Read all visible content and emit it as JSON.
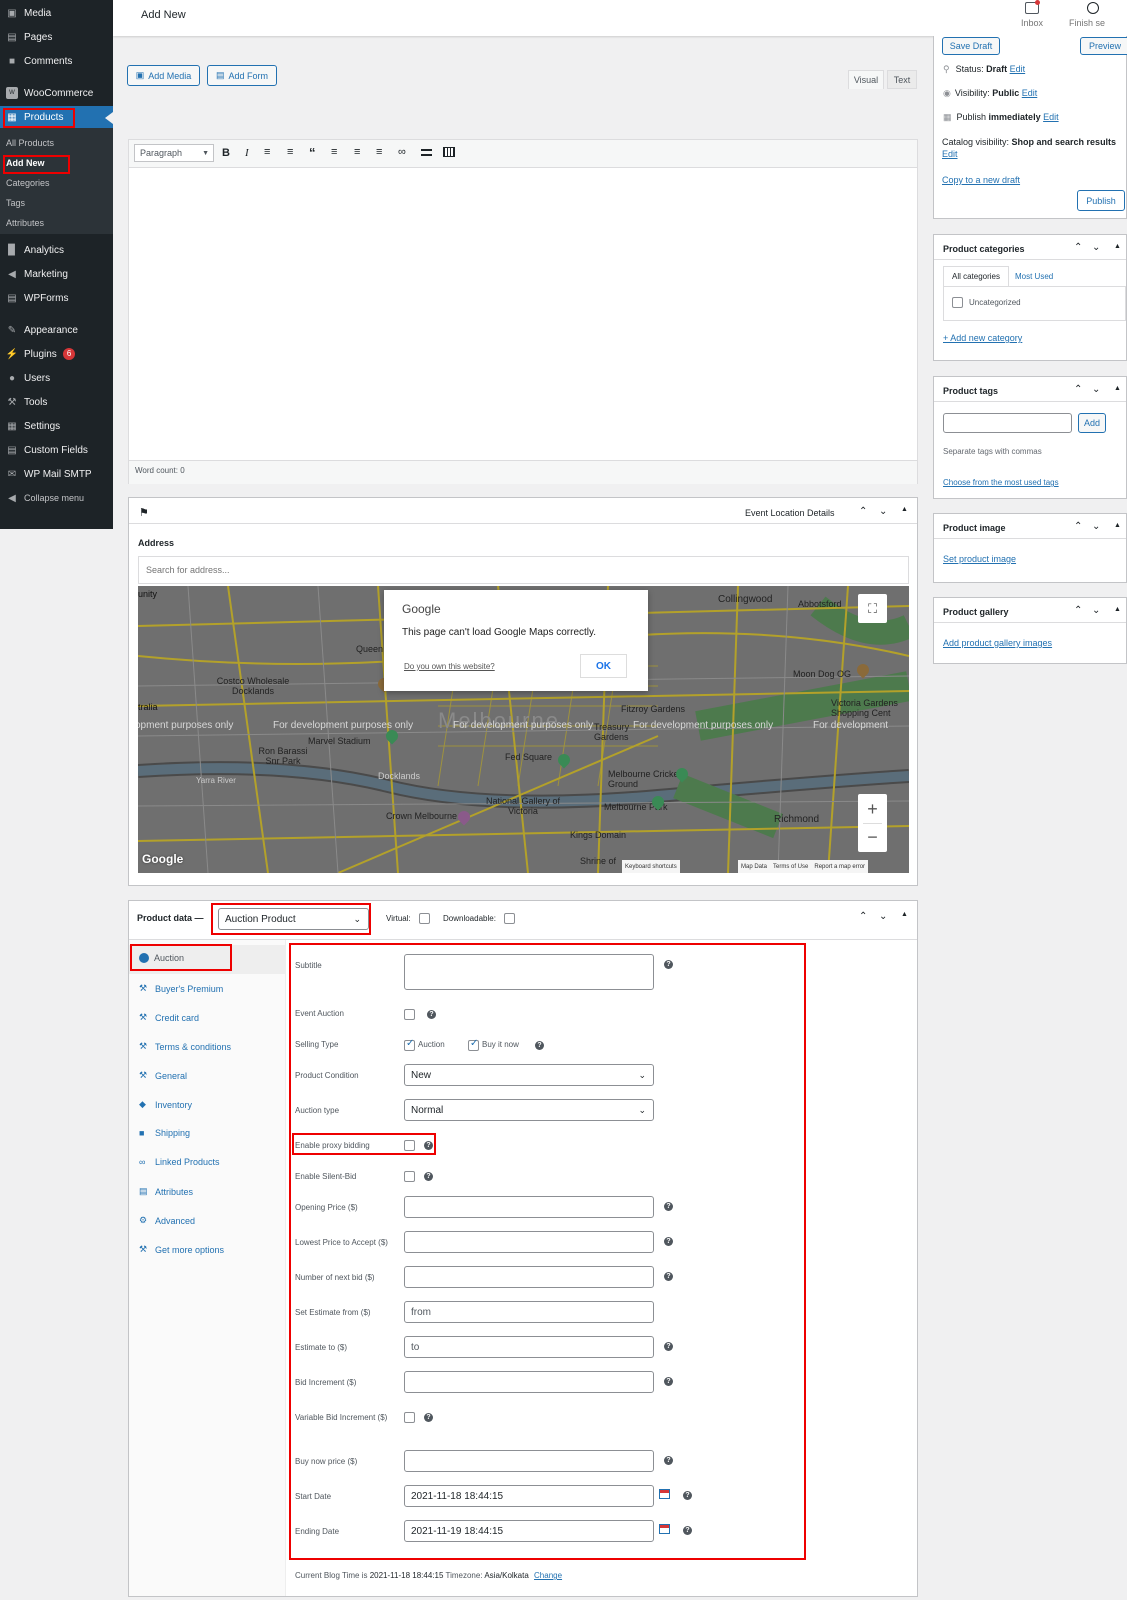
{
  "sidebar": {
    "top_items": [
      "Media",
      "Pages",
      "Comments"
    ],
    "woocommerce": "WooCommerce",
    "products": "Products",
    "submenu": [
      "All Products",
      "Add New",
      "Categories",
      "Tags",
      "Attributes"
    ],
    "items": [
      "Analytics",
      "Marketing",
      "WPForms",
      "Appearance",
      "Plugins",
      "Users",
      "Tools",
      "Settings",
      "Custom Fields",
      "WP Mail SMTP",
      "Collapse menu"
    ],
    "plugins_badge": "6"
  },
  "topbar": {
    "title": "Add New",
    "inbox": "Inbox",
    "finish": "Finish se"
  },
  "editor": {
    "add_media": "Add Media",
    "add_form": "Add Form",
    "tab_visual": "Visual",
    "tab_text": "Text",
    "format": "Paragraph",
    "word_count": "Word count: 0"
  },
  "event_box": {
    "title": "Event Location Details",
    "address_label": "Address",
    "address_placeholder": "Search for address...",
    "map": {
      "dialog_brand": "Google",
      "dialog_msg": "This page can't load Google Maps correctly.",
      "dialog_link": "Do you own this website?",
      "dialog_ok": "OK",
      "dev_text": "For development purposes only",
      "dev_left": "opment purposes only",
      "dev_right": "For development",
      "city": "Melbourne",
      "places": [
        "Collingwood",
        "Abbotsford",
        "Queen",
        "Costco Wholesale Docklands",
        "Moon Dog OG",
        "Fitzroy Gardens",
        "Victoria Gardens Shopping Cent",
        "Marvel Stadium",
        "Ron Barassi Snr Park",
        "Fed Square",
        "Docklands",
        "Melbourne Cricket Ground",
        "National Gallery of Victoria",
        "Melbourne Park",
        "Crown Melbourne",
        "Kings Domain",
        "Richmond",
        "Yarra River",
        "Shrine of",
        "unity",
        "tralia",
        "Treasury Gardens"
      ],
      "footer": [
        "Keyboard shortcuts",
        "Map Data",
        "Terms of Use",
        "Report a map error"
      ],
      "logo": "Google"
    }
  },
  "product_data": {
    "label": "Product data —",
    "type": "Auction Product",
    "virtual": "Virtual:",
    "downloadable": "Downloadable:",
    "tabs": [
      "Auction",
      "Buyer's Premium",
      "Credit card",
      "Terms & conditions",
      "General",
      "Inventory",
      "Shipping",
      "Linked Products",
      "Attributes",
      "Advanced",
      "Get more options"
    ],
    "fields": {
      "subtitle": "Subtitle",
      "event_auction": "Event Auction",
      "selling_type": "Selling Type",
      "selling_auction": "Auction",
      "selling_buy": "Buy it now",
      "product_condition": "Product Condition",
      "product_condition_value": "New",
      "auction_type": "Auction type",
      "auction_type_value": "Normal",
      "proxy": "Enable proxy bidding",
      "silent": "Enable Silent-Bid",
      "opening": "Opening Price ($)",
      "lowest": "Lowest Price to Accept ($)",
      "next_bid": "Number of next bid ($)",
      "est_from": "Set Estimate from ($)",
      "est_from_ph": "from",
      "est_to": "Estimate to ($)",
      "est_to_ph": "to",
      "bid_inc": "Bid Increment ($)",
      "var_bid": "Variable Bid Increment ($)",
      "buy_now": "Buy now price ($)",
      "start": "Start Date",
      "start_value": "2021-11-18 18:44:15",
      "end": "Ending Date",
      "end_value": "2021-11-19 18:44:15"
    },
    "footer_prefix": "Current Blog Time is ",
    "footer_time": "2021-11-18 18:44:15",
    "footer_tz": " Timezone: ",
    "footer_tz_value": "Asia/Kolkata",
    "footer_change": "Change"
  },
  "publish": {
    "save_draft": "Save Draft",
    "preview": "Preview",
    "status_label": "Status: ",
    "status_value": "Draft",
    "edit": "Edit",
    "visibility_label": "Visibility: ",
    "visibility_value": "Public",
    "publish_label": "Publish ",
    "publish_value": "immediately",
    "catalog_label": "Catalog visibility: ",
    "catalog_value": "Shop and search results",
    "copy": "Copy to a new draft",
    "publish_btn": "Publish"
  },
  "categories": {
    "title": "Product categories",
    "tab_all": "All categories",
    "tab_used": "Most Used",
    "item": "Uncategorized",
    "add": "+ Add new category"
  },
  "tags": {
    "title": "Product tags",
    "add_btn": "Add",
    "hint": "Separate tags with commas",
    "choose": "Choose from the most used tags"
  },
  "image": {
    "title": "Product image",
    "link": "Set product image"
  },
  "gallery": {
    "title": "Product gallery",
    "link": "Add product gallery images"
  }
}
